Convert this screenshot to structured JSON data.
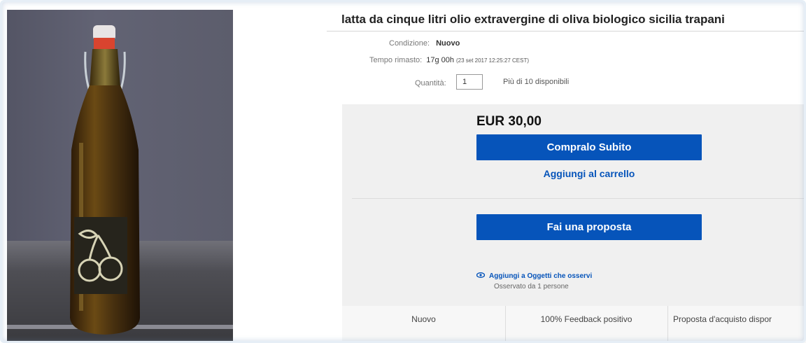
{
  "listing": {
    "title": "latta da cinque litri olio extravergine di oliva biologico sicilia trapani",
    "condition_label": "Condizione:",
    "condition_value": "Nuovo",
    "time_label": "Tempo rimasto:",
    "time_value": "17g 00h",
    "time_detail": "(23 set 2017   12:25:27 CEST)",
    "quantity_label": "Quantità:",
    "quantity_value": "1",
    "availability": "Più di 10 disponibili"
  },
  "buybox": {
    "price": "EUR 30,00",
    "buy_now": "Compralo Subito",
    "add_to_cart": "Aggiungi al carrello",
    "make_offer": "Fai una proposta",
    "watch_link": "Aggiungi a Oggetti che osservi",
    "watch_count": "Osservato da 1 persone"
  },
  "summary": {
    "condition": "Nuovo",
    "feedback": "100% Feedback positivo",
    "offer": "Proposta d'acquisto dispor"
  },
  "colors": {
    "primary_button": "#0654ba",
    "link": "#0654ba",
    "buybox_bg": "#f0f0f0"
  },
  "icons": {
    "watch": "eye-icon"
  }
}
